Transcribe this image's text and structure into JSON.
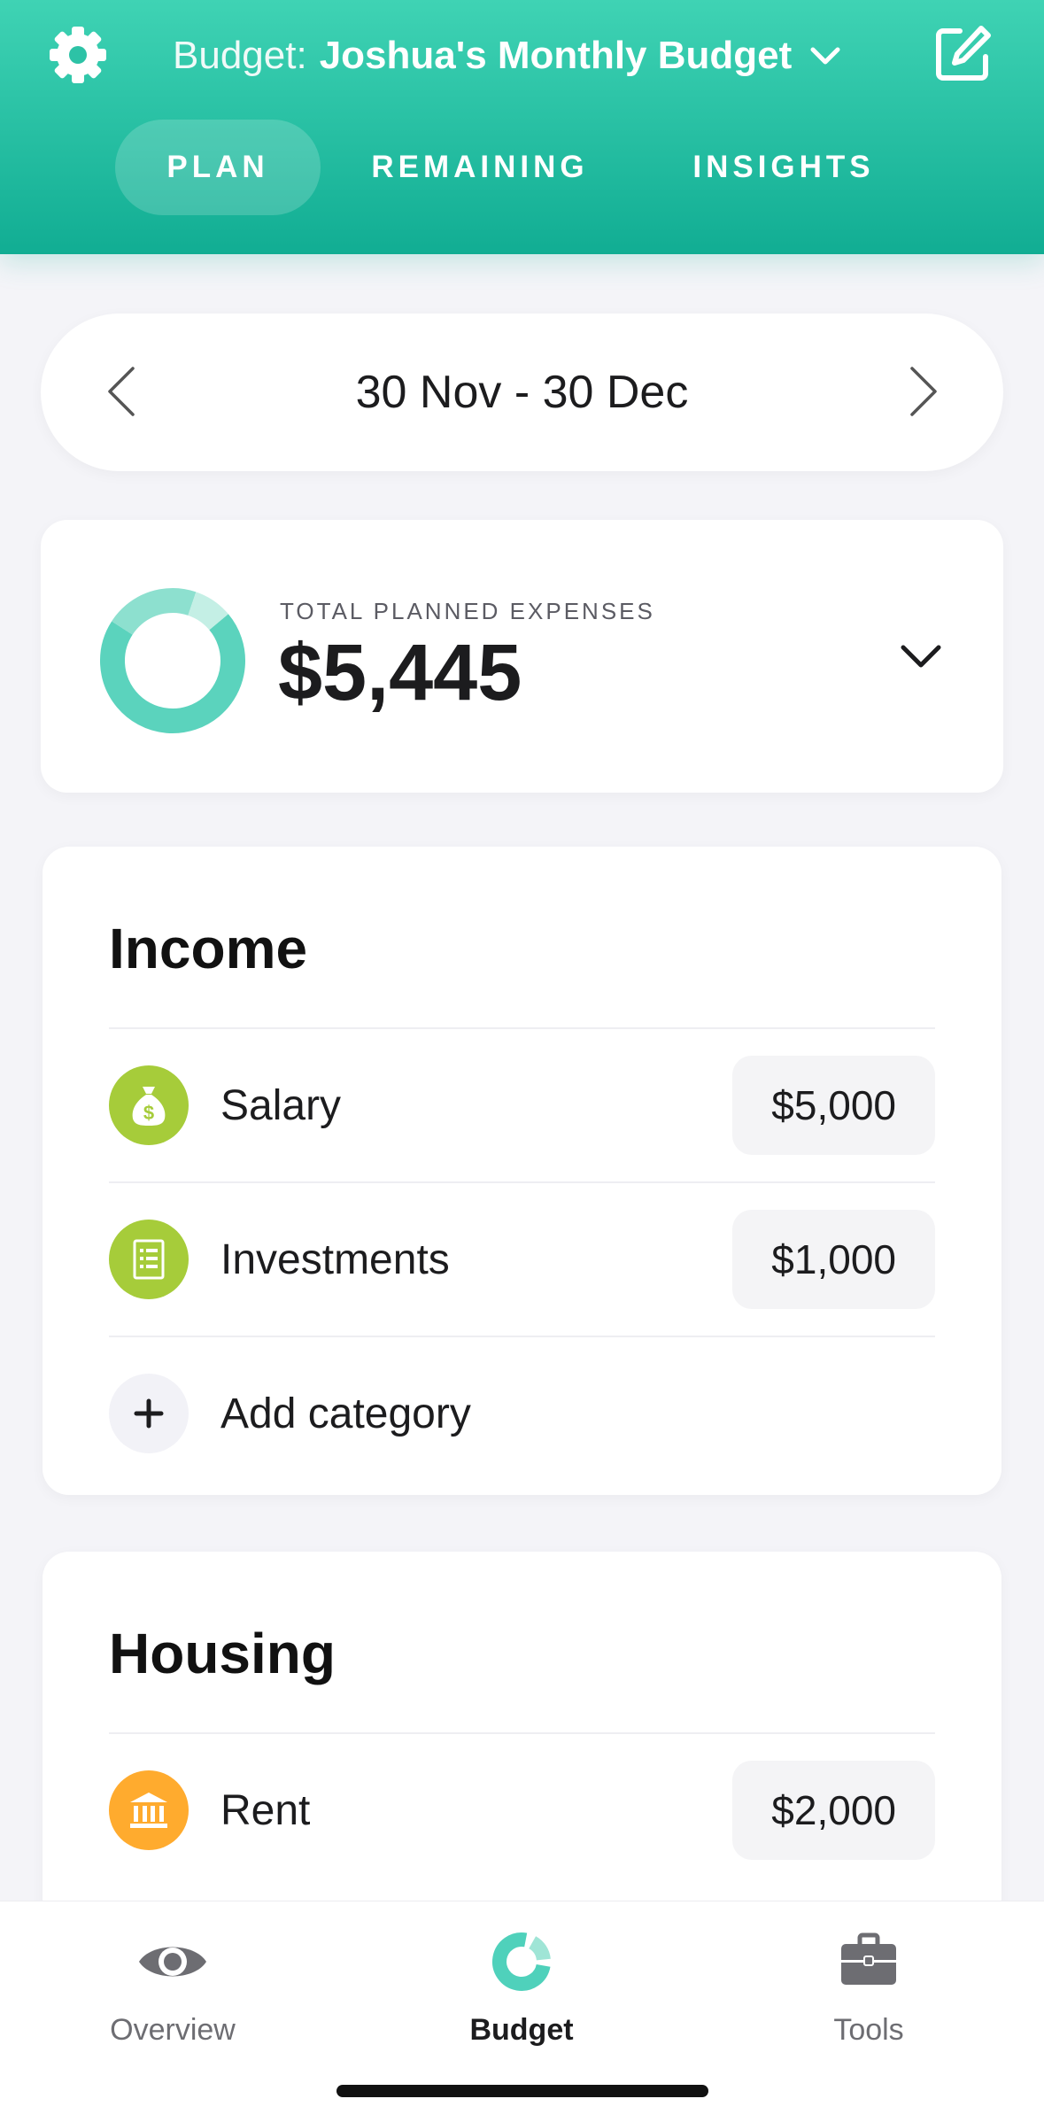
{
  "header": {
    "budget_prefix": "Budget:",
    "budget_name": "Joshua's Monthly Budget",
    "tabs": [
      {
        "label": "PLAN",
        "active": true
      },
      {
        "label": "REMAINING",
        "active": false
      },
      {
        "label": "INSIGHTS",
        "active": false
      }
    ]
  },
  "period": {
    "label": "30 Nov - 30 Dec"
  },
  "total": {
    "caption": "TOTAL PLANNED EXPENSES",
    "amount": "$5,445"
  },
  "income": {
    "title": "Income",
    "rows": [
      {
        "label": "Salary",
        "value": "$5,000",
        "icon": "money-bag-icon"
      },
      {
        "label": "Investments",
        "value": "$1,000",
        "icon": "document-icon"
      }
    ],
    "add_label": "Add category"
  },
  "housing": {
    "title": "Housing",
    "rows": [
      {
        "label": "Rent",
        "value": "$2,000",
        "icon": "bank-icon"
      }
    ]
  },
  "tabbar": {
    "items": [
      {
        "label": "Overview",
        "icon": "eye-icon"
      },
      {
        "label": "Budget",
        "icon": "budget-donut-icon",
        "active": true
      },
      {
        "label": "Tools",
        "icon": "toolbox-icon"
      }
    ]
  },
  "colors": {
    "header_top": "#3fd3b4",
    "header_bottom": "#11ad93",
    "accent": "#4fd1bb",
    "income_icon": "#a6cc3a",
    "housing_icon": "#ffab2e"
  }
}
